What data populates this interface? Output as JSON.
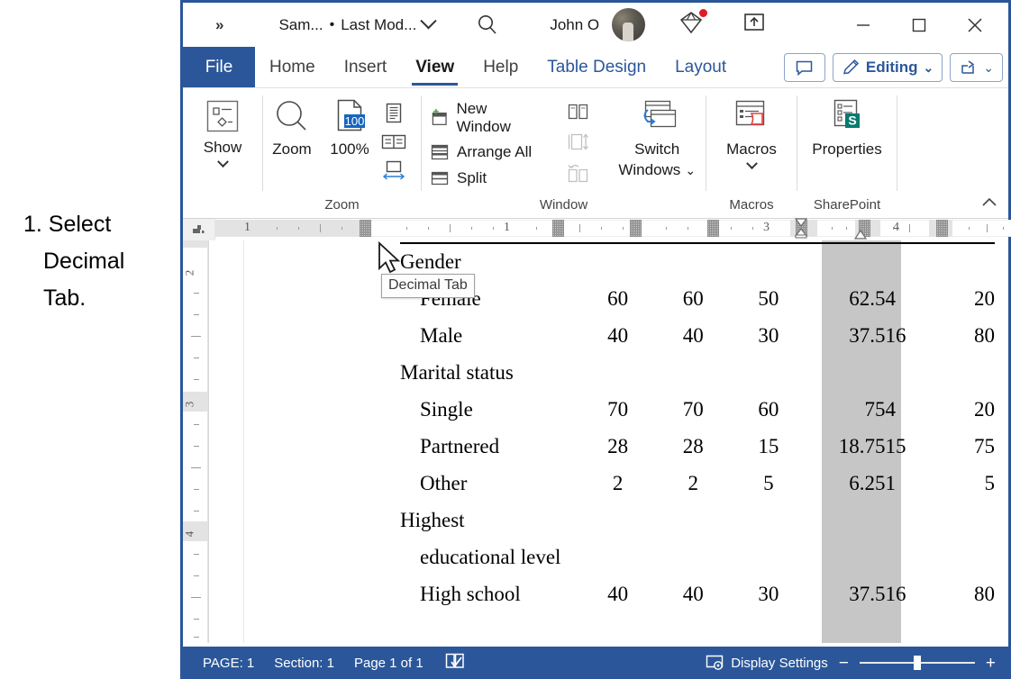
{
  "annotation": {
    "text": "1. Select\nDecimal\nTab."
  },
  "titlebar": {
    "chevrons": "»",
    "doc_name": "Sam...",
    "separator": "•",
    "last_modified": "Last Mod...",
    "user_name": "John O",
    "icons": {
      "search": "search-icon",
      "avatar": "user-avatar",
      "gem": "diamond-icon",
      "share": "share-upload-icon",
      "minimize": "minimize-icon",
      "maximize": "maximize-icon",
      "close": "close-icon"
    }
  },
  "tabs": {
    "file": "File",
    "items": [
      {
        "label": "Home",
        "active": false,
        "accent": false
      },
      {
        "label": "Insert",
        "active": false,
        "accent": false
      },
      {
        "label": "View",
        "active": true,
        "accent": false
      },
      {
        "label": "Help",
        "active": false,
        "accent": false
      },
      {
        "label": "Table Design",
        "active": false,
        "accent": true
      },
      {
        "label": "Layout",
        "active": false,
        "accent": true
      }
    ],
    "comments_label": "",
    "editing_label": "Editing",
    "share_label": ""
  },
  "ribbon": {
    "groups": [
      {
        "name": "Show",
        "label": ""
      },
      {
        "name": "Zoom",
        "label": "Zoom"
      },
      {
        "name": "Window",
        "label": "Window"
      },
      {
        "name": "Macros",
        "label": "Macros"
      },
      {
        "name": "SharePoint",
        "label": "SharePoint"
      }
    ],
    "show_button": "Show",
    "zoom_button": "Zoom",
    "zoom_100_button": "100%",
    "zoom_100_badge": "100",
    "new_window": "New Window",
    "arrange_all": "Arrange All",
    "split": "Split",
    "switch_windows": "Switch\nWindows",
    "switch_windows_line1": "Switch",
    "switch_windows_line2": "Windows",
    "macros_button": "Macros",
    "properties_button": "Properties"
  },
  "ruler": {
    "tab_selector_type": "decimal-tab",
    "h_labels": [
      "1",
      "1",
      "3",
      "4"
    ],
    "v_labels": [
      "2",
      "3",
      "4"
    ]
  },
  "tooltip": {
    "text": "Decimal Tab"
  },
  "document": {
    "rows": [
      {
        "type": "group",
        "label": "Gender",
        "values": []
      },
      {
        "type": "data",
        "label": "Female",
        "values": [
          "60",
          "60",
          "50",
          "62.5",
          "4",
          "20"
        ]
      },
      {
        "type": "data",
        "label": "Male",
        "values": [
          "40",
          "40",
          "30",
          "37.5",
          "16",
          "80"
        ]
      },
      {
        "type": "group",
        "label": "Marital status",
        "values": []
      },
      {
        "type": "data",
        "label": "Single",
        "values": [
          "70",
          "70",
          "60",
          "75",
          "4",
          "20"
        ]
      },
      {
        "type": "data",
        "label": "Partnered",
        "values": [
          "28",
          "28",
          "15",
          "18.75",
          "15",
          "75"
        ]
      },
      {
        "type": "data",
        "label": "Other",
        "values": [
          "2",
          "2",
          "5",
          "6.25",
          "1",
          "5"
        ]
      },
      {
        "type": "group",
        "label": "Highest",
        "values": []
      },
      {
        "type": "group2",
        "label": "educational level",
        "values": []
      },
      {
        "type": "data",
        "label": "High school",
        "values": [
          "40",
          "40",
          "30",
          "37.5",
          "16",
          "80"
        ]
      }
    ],
    "selection_color": "#c6c6c6"
  },
  "statusbar": {
    "page": "PAGE: 1",
    "section": "Section: 1",
    "page_of": "Page 1 of 1",
    "display_settings": "Display Settings",
    "zoom_minus": "−",
    "zoom_plus": "+"
  },
  "colors": {
    "accent": "#2b579a",
    "ribbon_accent": "#2b579a",
    "red_dot": "#e01b24",
    "sharepoint_teal": "#057b6e"
  }
}
